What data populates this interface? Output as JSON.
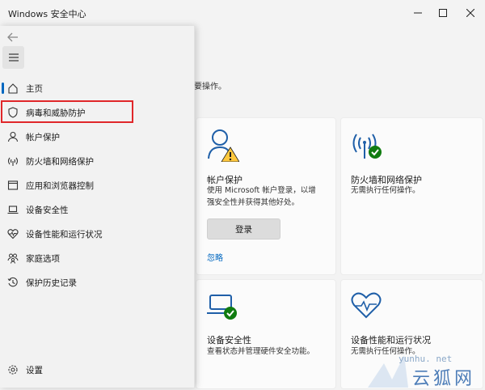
{
  "window": {
    "title": "Windows 安全中心"
  },
  "main": {
    "subtext": "必要操作。",
    "cards": {
      "account": {
        "title": "帐户保护",
        "desc1": "使用 Microsoft 帐户登录，以增",
        "desc2": "强安全性并获得其他好处。",
        "button": "登录",
        "link": "忽略"
      },
      "firewall": {
        "title": "防火墙和网络保护",
        "desc": "无需执行任何操作。"
      },
      "device": {
        "title": "设备安全性",
        "desc": "查看状态并管理硬件安全功能。"
      },
      "performance": {
        "title": "设备性能和运行状况",
        "desc": "无需执行任何操作。"
      }
    }
  },
  "sidebar": {
    "items": [
      {
        "label": "主页",
        "icon": "home-icon"
      },
      {
        "label": "病毒和威胁防护",
        "icon": "shield-icon"
      },
      {
        "label": "帐户保护",
        "icon": "person-icon"
      },
      {
        "label": "防火墙和网络保护",
        "icon": "wifi-antenna-icon"
      },
      {
        "label": "应用和浏览器控制",
        "icon": "browser-window-icon"
      },
      {
        "label": "设备安全性",
        "icon": "laptop-icon"
      },
      {
        "label": "设备性能和运行状况",
        "icon": "heart-pulse-icon"
      },
      {
        "label": "家庭选项",
        "icon": "family-icon"
      },
      {
        "label": "保护历史记录",
        "icon": "history-icon"
      }
    ],
    "settings_label": "设置"
  },
  "watermark": {
    "url": "yunhu. net",
    "text": "云狐网"
  },
  "colors": {
    "accent": "#0067c0",
    "success": "#107c10",
    "warning": "#ffc83d",
    "highlight": "#e0272a"
  }
}
